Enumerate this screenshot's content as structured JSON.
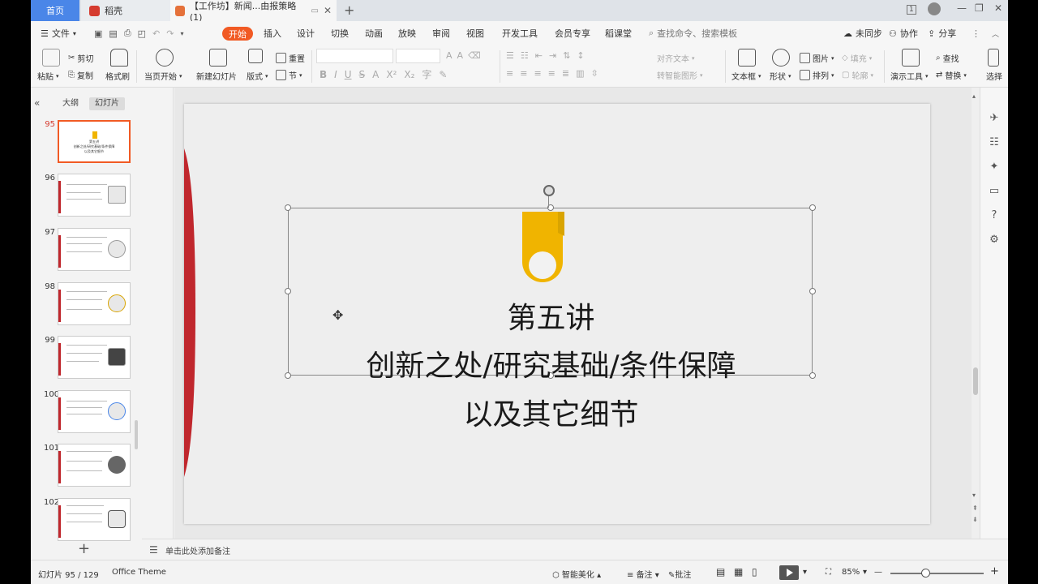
{
  "tabs": {
    "home": "首页",
    "draft": "稻壳",
    "doc": "【工作坊】新闻...由报策略(1)"
  },
  "window": {
    "min": "—",
    "restore": "❐",
    "close": "✕",
    "badge": "1"
  },
  "menu": {
    "file": "文件",
    "items": [
      "开始",
      "插入",
      "设计",
      "切换",
      "动画",
      "放映",
      "审阅",
      "视图",
      "开发工具",
      "会员专享",
      "稻课堂"
    ],
    "search": "查找命令、搜索模板",
    "sync": "未同步",
    "collab": "协作",
    "share": "分享"
  },
  "ribbon": {
    "paste": "粘贴",
    "cut": "剪切",
    "copy": "复制",
    "format_painter": "格式刷",
    "from_start": "当页开始",
    "new_slide": "新建幻灯片",
    "layout": "版式",
    "reset": "重置",
    "section": "节",
    "align_text": "对齐文本",
    "smart_graphic": "转智能图形",
    "textbox": "文本框",
    "shape": "形状",
    "picture": "图片",
    "arrange": "排列",
    "fill": "填充",
    "outline": "轮廓",
    "present_tools": "演示工具",
    "find": "查找",
    "replace": "替换",
    "more": "选择"
  },
  "left_panel": {
    "outline_tab": "大纲",
    "slides_tab": "幻灯片",
    "slides": [
      {
        "num": "95",
        "active": true
      },
      {
        "num": "96",
        "active": false
      },
      {
        "num": "97",
        "active": false
      },
      {
        "num": "98",
        "active": false
      },
      {
        "num": "99",
        "active": false
      },
      {
        "num": "100",
        "active": false
      },
      {
        "num": "101",
        "active": false
      },
      {
        "num": "102",
        "active": false
      }
    ],
    "thumb95_lines": [
      "第五讲",
      "创新之处/研究基础/条件保障",
      "以及其它细节"
    ]
  },
  "slide": {
    "title": "第五讲",
    "line1": "创新之处/研究基础/条件保障",
    "line2": "以及其它细节",
    "accent_color": "#f0b400",
    "bar_color": "#c0272d"
  },
  "notes": {
    "placeholder": "单击此处添加备注"
  },
  "status": {
    "slide_info": "幻灯片 95 / 129",
    "theme": "Office Theme",
    "smart_beautify": "智能美化",
    "notes_btn": "备注",
    "comment_btn": "批注",
    "zoom": "85%"
  }
}
